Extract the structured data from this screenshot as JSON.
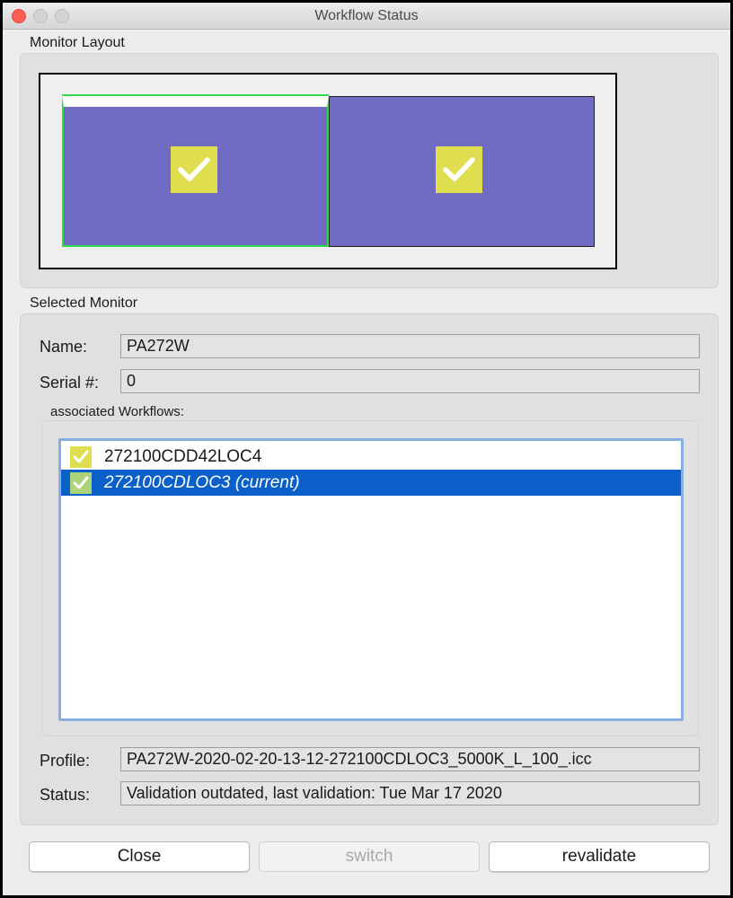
{
  "window": {
    "title": "Workflow Status"
  },
  "monitor_layout": {
    "label": "Monitor Layout",
    "monitors": [
      {
        "selected": true,
        "validated": true
      },
      {
        "selected": false,
        "validated": true
      }
    ]
  },
  "selected_monitor": {
    "label": "Selected Monitor",
    "name_label": "Name:",
    "name_value": "PA272W",
    "serial_label": "Serial #:",
    "serial_value": "0",
    "workflows_label": "associated Workflows:",
    "workflows": [
      {
        "label": "272100CDD42LOC4",
        "checked": true,
        "selected": false
      },
      {
        "label": "272100CDLOC3 (current)",
        "checked": true,
        "selected": true
      }
    ],
    "profile_label": "Profile:",
    "profile_value": "PA272W-2020-02-20-13-12-272100CDLOC3_5000K_L_100_.icc",
    "status_label": "Status:",
    "status_value": "Validation outdated, last validation: Tue Mar 17 2020"
  },
  "buttons": {
    "close": "Close",
    "switch": "switch",
    "revalidate": "revalidate"
  },
  "colors": {
    "monitor_fill": "#716bc4",
    "check_badge": "#dede4f",
    "selection_outline": "#2fd94a",
    "list_selection": "#0b5fc9"
  }
}
